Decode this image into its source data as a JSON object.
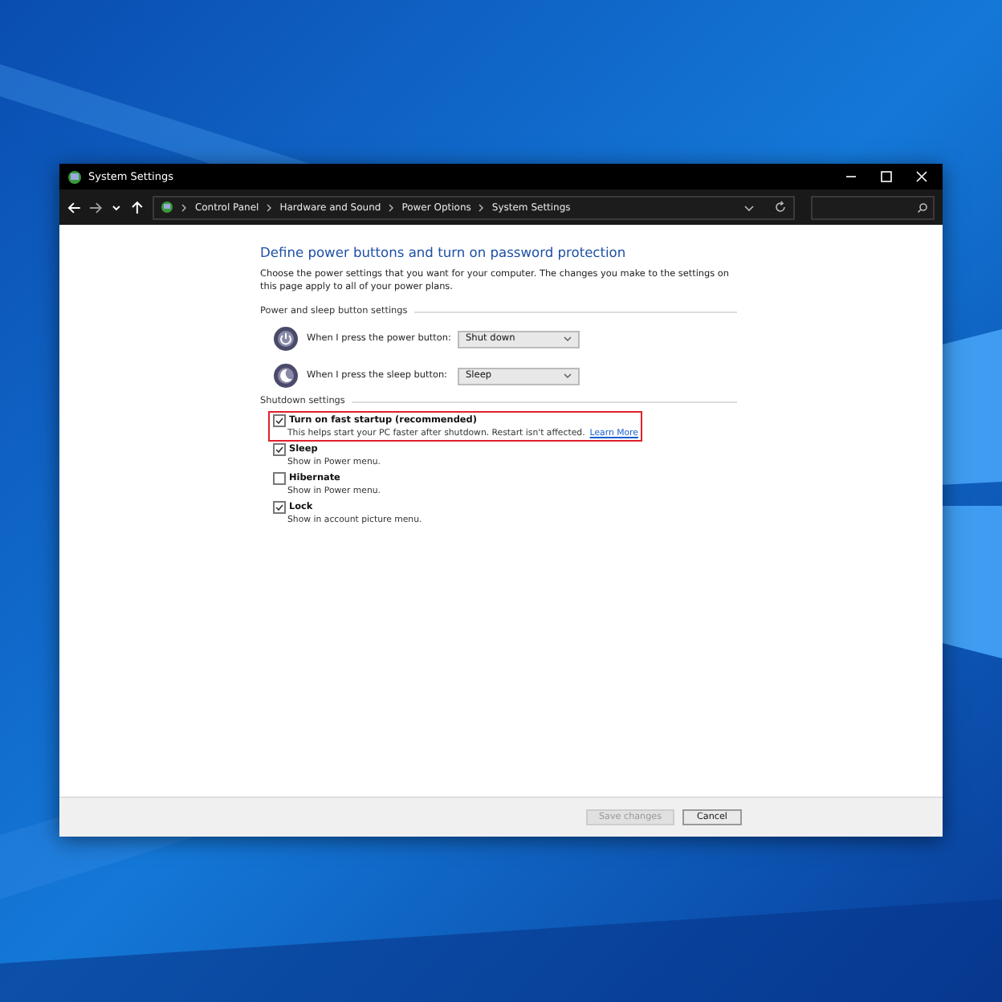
{
  "window": {
    "title": "System Settings"
  },
  "address_bar": {
    "breadcrumbs": [
      "Control Panel",
      "Hardware and Sound",
      "Power Options",
      "System Settings"
    ]
  },
  "heading": "Define power buttons and turn on password protection",
  "intro": "Choose the power settings that you want for your computer. The changes you make to the settings on this page apply to all of your power plans.",
  "power_section": {
    "title": "Power and sleep button settings",
    "rows": [
      {
        "kind": "power",
        "label": "When I press the power button:",
        "value": "Shut down"
      },
      {
        "kind": "sleep",
        "label": "When I press the sleep button:",
        "value": "Sleep"
      }
    ]
  },
  "shutdown_section": {
    "title": "Shutdown settings",
    "options": [
      {
        "label": "Turn on fast startup (recommended)",
        "description": "This helps start your PC faster after shutdown. Restart isn't affected.",
        "link": "Learn More",
        "checked": true,
        "highlighted": true
      },
      {
        "label": "Sleep",
        "description": "Show in Power menu.",
        "checked": true,
        "highlighted": false
      },
      {
        "label": "Hibernate",
        "description": "Show in Power menu.",
        "checked": false,
        "highlighted": false
      },
      {
        "label": "Lock",
        "description": "Show in account picture menu.",
        "checked": true,
        "highlighted": false
      }
    ]
  },
  "buttons": [
    {
      "label": "Save changes",
      "disabled": true
    },
    {
      "label": "Cancel",
      "disabled": false
    }
  ]
}
